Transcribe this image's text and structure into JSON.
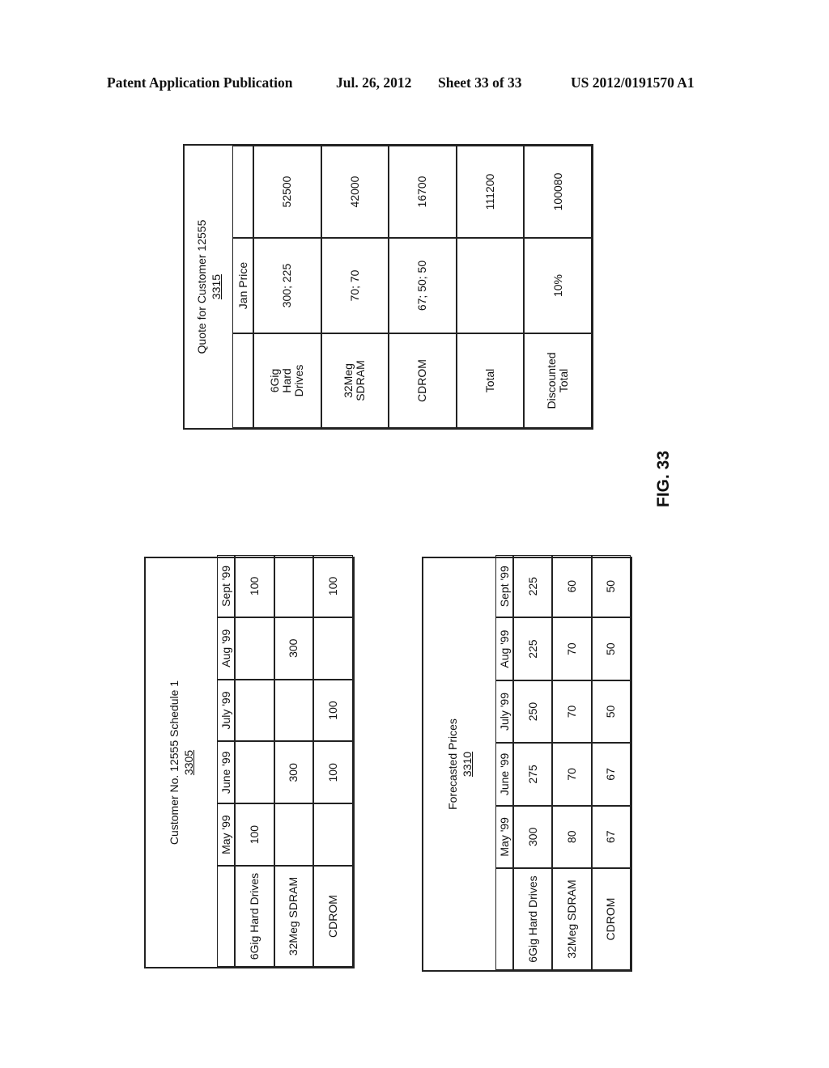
{
  "header": {
    "publication": "Patent Application Publication",
    "date": "Jul. 26, 2012",
    "sheet": "Sheet 33 of 33",
    "number": "US 2012/0191570 A1"
  },
  "figure_label": "FIG. 33",
  "schedule_table": {
    "title": "Customer No. 12555 Schedule 1",
    "ref": "3305",
    "columns": [
      "May '99",
      "June '99",
      "July '99",
      "Aug '99",
      "Sept '99"
    ],
    "rows": [
      {
        "label": "6Gig Hard Drives",
        "values": [
          "100",
          "",
          "",
          "",
          "100"
        ]
      },
      {
        "label": "32Meg SDRAM",
        "values": [
          "",
          "300",
          "",
          "300",
          ""
        ]
      },
      {
        "label": "CDROM",
        "values": [
          "",
          "100",
          "100",
          "",
          "100"
        ]
      }
    ]
  },
  "prices_table": {
    "title": "Forecasted Prices",
    "ref": "3310",
    "columns": [
      "May '99",
      "June '99",
      "July '99",
      "Aug '99",
      "Sept '99"
    ],
    "rows": [
      {
        "label": "6Gig Hard Drives",
        "values": [
          "300",
          "275",
          "250",
          "225",
          "225"
        ]
      },
      {
        "label": "32Meg SDRAM",
        "values": [
          "80",
          "70",
          "70",
          "70",
          "60"
        ]
      },
      {
        "label": "CDROM",
        "values": [
          "67",
          "67",
          "50",
          "50",
          "50"
        ]
      }
    ]
  },
  "quote_table": {
    "title": "Quote for Customer 12555",
    "ref": "3315",
    "columns": [
      "Jan Price",
      ""
    ],
    "rows": [
      {
        "label": "6Gig Hard Drives",
        "price": "300; 225",
        "total": "52500"
      },
      {
        "label": "32Meg SDRAM",
        "price": "70; 70",
        "total": "42000"
      },
      {
        "label": "CDROM",
        "price": "67; 50; 50",
        "total": "16700"
      },
      {
        "label": "Total",
        "price": "",
        "total": "111200"
      },
      {
        "label": "Discounted Total",
        "price": "10%",
        "total": "100080"
      }
    ]
  }
}
